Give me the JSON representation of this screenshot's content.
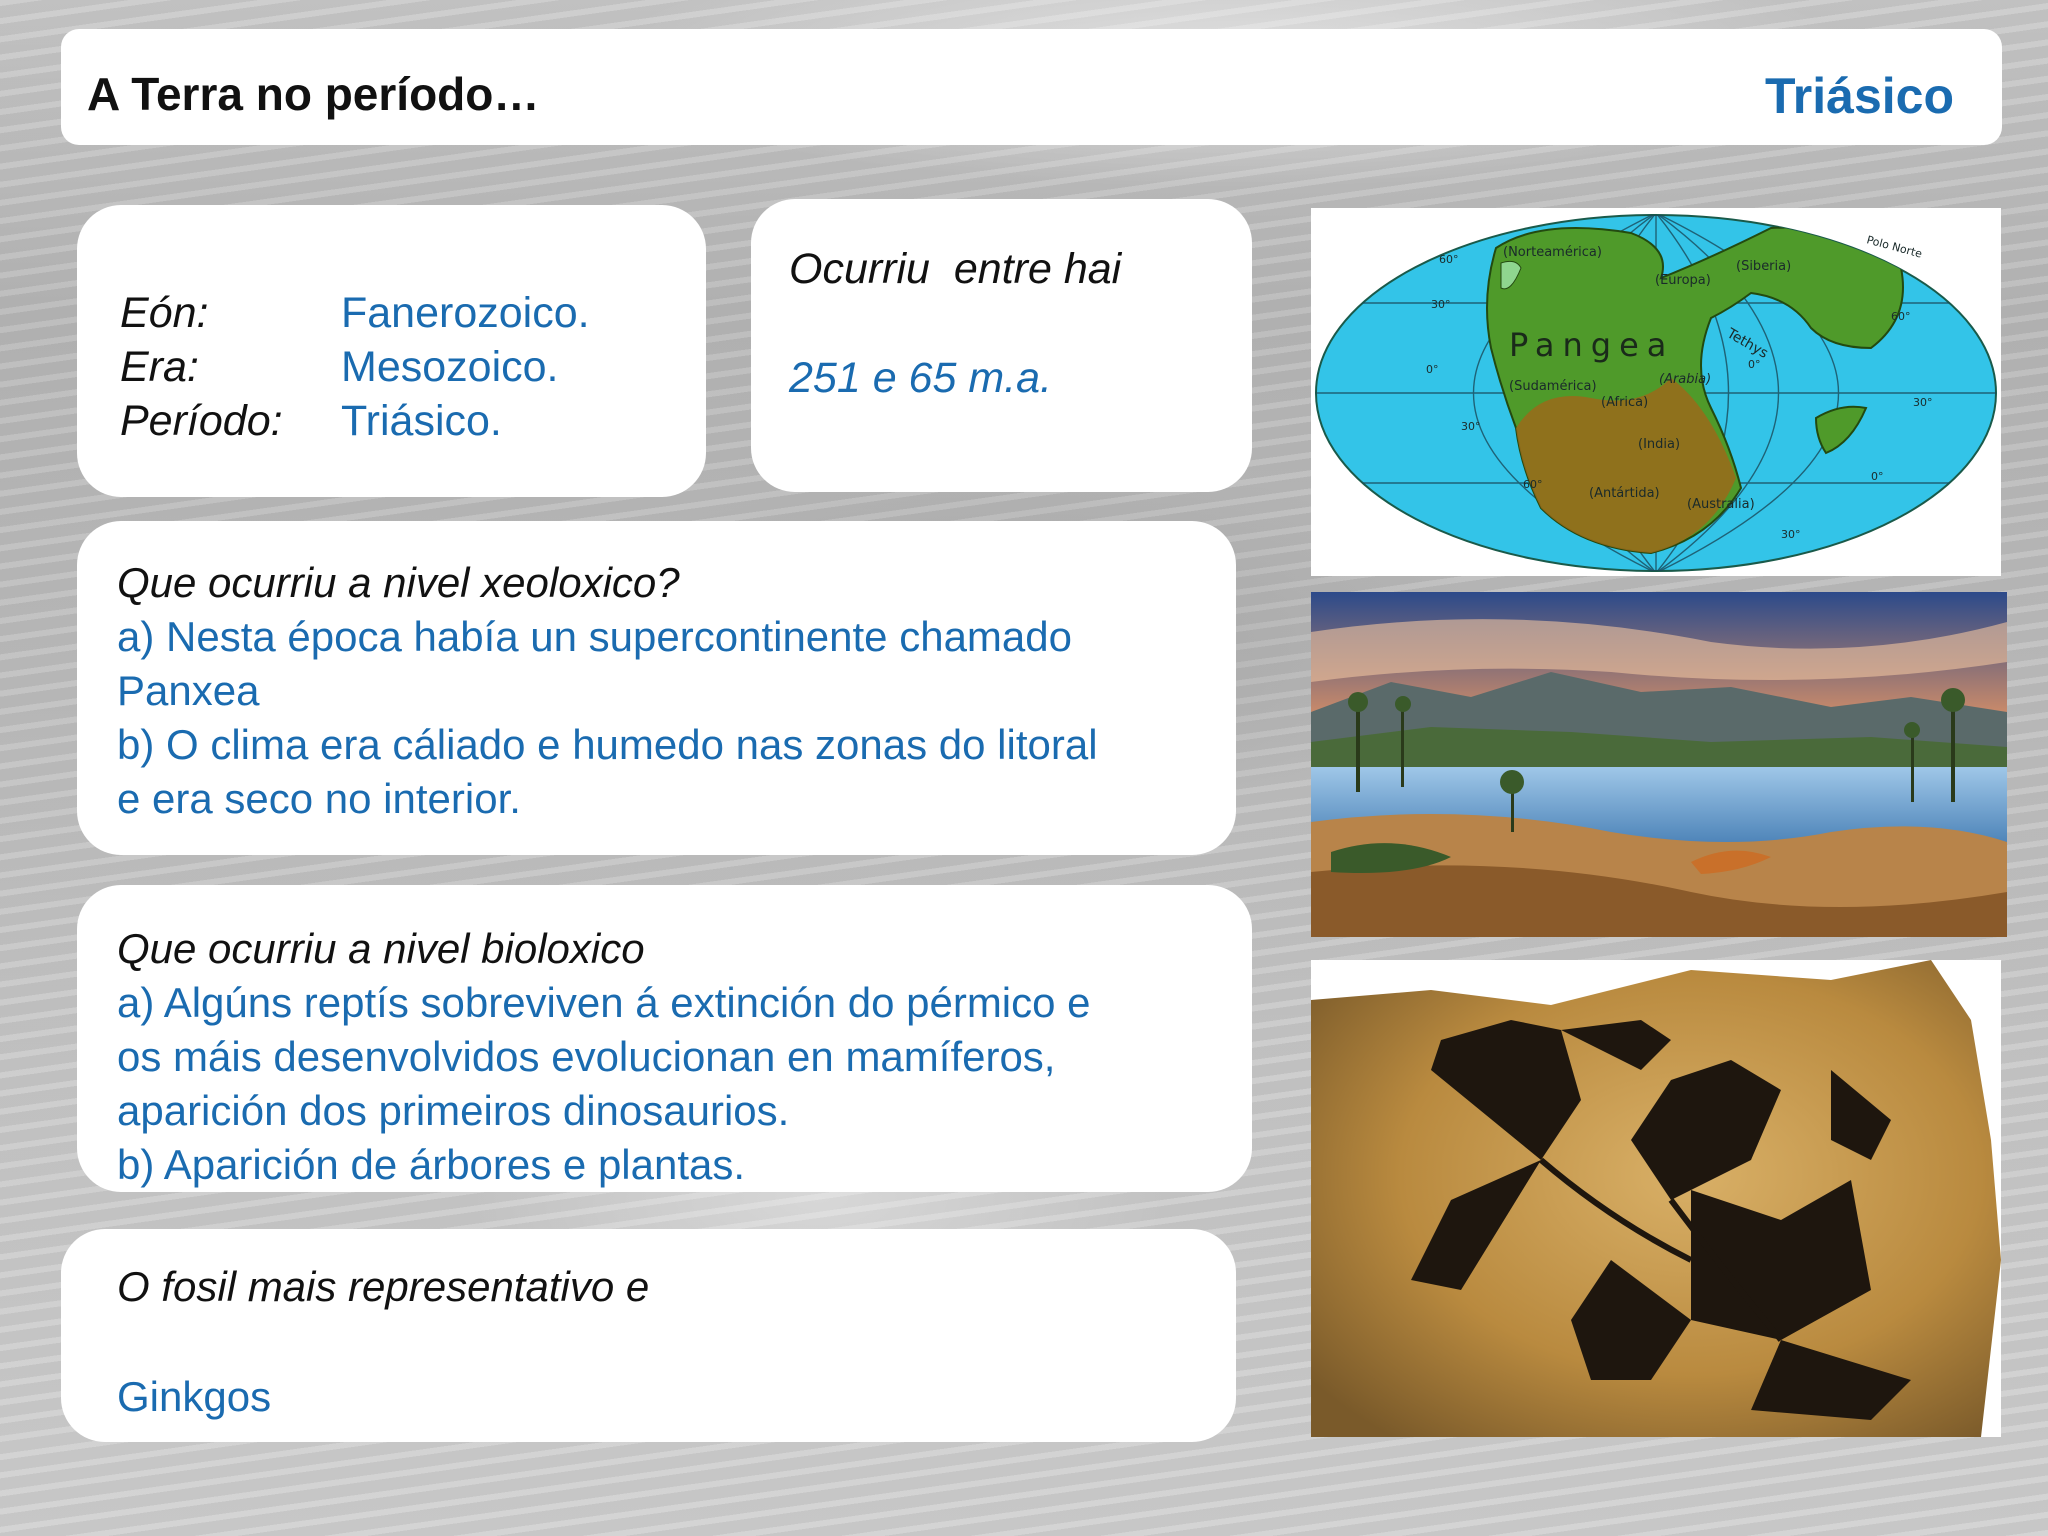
{
  "header": {
    "title": "A Terra no período…",
    "period": "Triásico"
  },
  "classification": {
    "eon_label": "Eón:",
    "eon_value": "Fanerozoico.",
    "era_label": "Era:",
    "era_value": "Mesozoico.",
    "period_label": "Período:",
    "period_value": "Triásico."
  },
  "time_range": {
    "label": "Ocurriu  entre hai",
    "value": "251 e 65 m.a."
  },
  "geology": {
    "question": "Que ocurriu a nivel xeoloxico?",
    "lines": [
      "a) Nesta época había un supercontinente chamado",
      "Panxea",
      "b) O clima era cáliado e humedo nas zonas do litoral",
      "e era seco no interior."
    ]
  },
  "biology": {
    "question": "Que ocurriu a nivel bioloxico",
    "lines": [
      "a) Algúns reptís sobreviven á extinción do pérmico e",
      "os máis desenvolvidos evolucionan en mamíferos,",
      "aparición dos primeiros dinosaurios.",
      "b) Aparición de árbores e plantas."
    ]
  },
  "fossil": {
    "label": "O fosil mais representativo e",
    "value": "Ginkgos"
  },
  "map": {
    "title": "Pangea",
    "labels": [
      "(Norteamérica)",
      "(Europa)",
      "(Siberia)",
      "(Sudamérica)",
      "(Africa)",
      "(Arabia)",
      "(India)",
      "(Antártida)",
      "(Australia)",
      "Tethys",
      "Polo Norte"
    ],
    "degrees": [
      "60°",
      "30°",
      "0°",
      "30°",
      "60°",
      "30°",
      "60°",
      "0°",
      "30°",
      "0°"
    ]
  },
  "colors": {
    "accent": "#1a6bb0",
    "ocean": "#33c4e8",
    "land": "#4f9a2a",
    "land_dark": "#9a6a1a"
  }
}
